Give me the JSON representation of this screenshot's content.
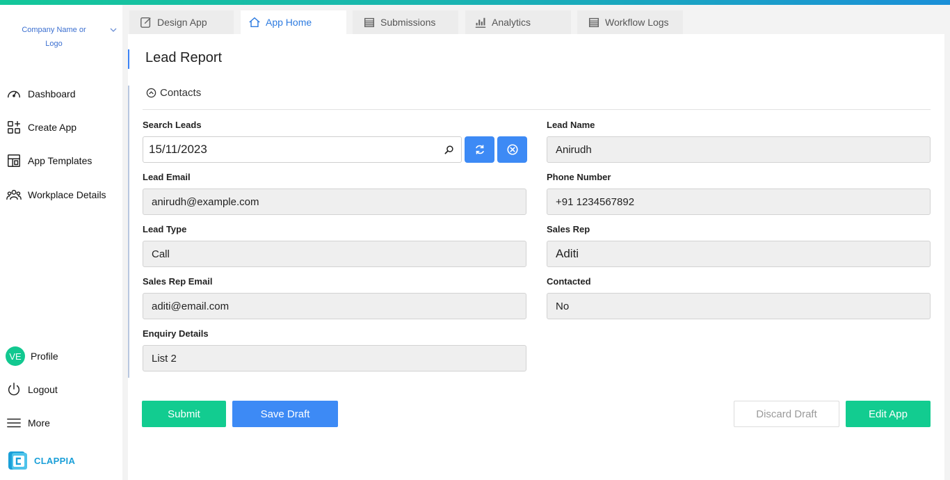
{
  "sidebar": {
    "company": "Company Name or Logo",
    "items": [
      {
        "label": "Dashboard"
      },
      {
        "label": "Create App"
      },
      {
        "label": "App Templates"
      },
      {
        "label": "Workplace Details"
      }
    ],
    "profile": {
      "initials": "VE",
      "label": "Profile"
    },
    "logout": "Logout",
    "more": "More",
    "brand": "CLAPPIA"
  },
  "tabs": [
    {
      "label": "Design App",
      "icon": "edit-icon"
    },
    {
      "label": "App Home",
      "icon": "home-icon"
    },
    {
      "label": "Submissions",
      "icon": "list-icon"
    },
    {
      "label": "Analytics",
      "icon": "bar-chart-icon"
    },
    {
      "label": "Workflow Logs",
      "icon": "list-icon"
    }
  ],
  "page": {
    "title": "Lead Report",
    "section": "Contacts"
  },
  "form": {
    "search_leads": {
      "label": "Search Leads",
      "value": "15/11/2023"
    },
    "lead_name": {
      "label": "Lead Name",
      "value": "Anirudh"
    },
    "lead_email": {
      "label": "Lead Email",
      "value": "anirudh@example.com"
    },
    "phone_number": {
      "label": "Phone Number",
      "value": "+91 1234567892"
    },
    "lead_type": {
      "label": "Lead Type",
      "value": "Call"
    },
    "sales_rep": {
      "label": "Sales Rep",
      "value": "Aditi"
    },
    "sales_rep_email": {
      "label": "Sales Rep Email",
      "value": "aditi@email.com"
    },
    "contacted": {
      "label": "Contacted",
      "value": "No"
    },
    "enquiry_details": {
      "label": "Enquiry Details",
      "value": "List 2"
    }
  },
  "actions": {
    "submit": "Submit",
    "save_draft": "Save Draft",
    "discard_draft": "Discard Draft",
    "edit_app": "Edit App"
  },
  "colors": {
    "accent_blue": "#3d8af5",
    "accent_green": "#12cc90",
    "brand_blue": "#1a9fd8"
  }
}
